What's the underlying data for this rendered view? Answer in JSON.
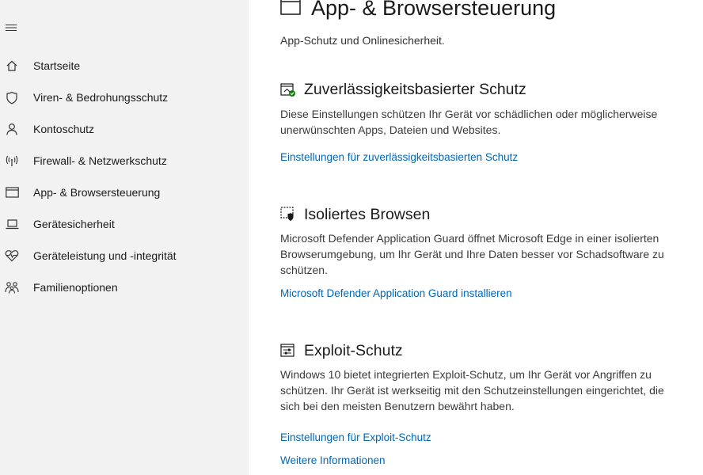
{
  "sidebar": {
    "menu_icon": "hamburger-icon",
    "items": [
      {
        "label": "Startseite",
        "icon": "home-icon"
      },
      {
        "label": "Viren- & Bedrohungsschutz",
        "icon": "shield-icon"
      },
      {
        "label": "Kontoschutz",
        "icon": "person-icon"
      },
      {
        "label": "Firewall- & Netzwerkschutz",
        "icon": "antenna-icon"
      },
      {
        "label": "App- & Browsersteuerung",
        "icon": "browser-window-icon"
      },
      {
        "label": "Gerätesicherheit",
        "icon": "laptop-icon"
      },
      {
        "label": "Geräteleistung und -integrität",
        "icon": "heart-pulse-icon"
      },
      {
        "label": "Familienoptionen",
        "icon": "family-icon"
      }
    ]
  },
  "main": {
    "title": "App- & Browsersteuerung",
    "subtitle": "App-Schutz und Onlinesicherheit.",
    "sections": [
      {
        "title": "Zuverlässigkeitsbasierter Schutz",
        "icon": "reputation-check-icon",
        "description": "Diese Einstellungen schützen Ihr Gerät vor schädlichen oder möglicherweise unerwünschten Apps, Dateien und Websites.",
        "links": [
          "Einstellungen für zuverlässigkeitsbasierten Schutz"
        ]
      },
      {
        "title": "Isoliertes Browsen",
        "icon": "isolated-browsing-icon",
        "description": "Microsoft Defender Application Guard öffnet Microsoft Edge in einer isolierten Browserumgebung, um Ihr Gerät und Ihre Daten besser vor Schadsoftware zu schützen.",
        "links": [
          "Microsoft Defender Application Guard installieren"
        ]
      },
      {
        "title": "Exploit-Schutz",
        "icon": "exploit-protection-icon",
        "description": "Windows 10 bietet integrierten Exploit-Schutz, um Ihr Gerät vor Angriffen zu schützen.   Ihr Gerät ist werkseitig mit den Schutzeinstellungen eingerichtet, die sich bei den meisten Benutzern bewährt haben.",
        "links": [
          "Einstellungen für Exploit-Schutz",
          "Weitere Informationen"
        ]
      }
    ]
  },
  "colors": {
    "sidebar_bg": "#f2f2f2",
    "link": "#0067b8",
    "accent_green": "#107c10"
  }
}
